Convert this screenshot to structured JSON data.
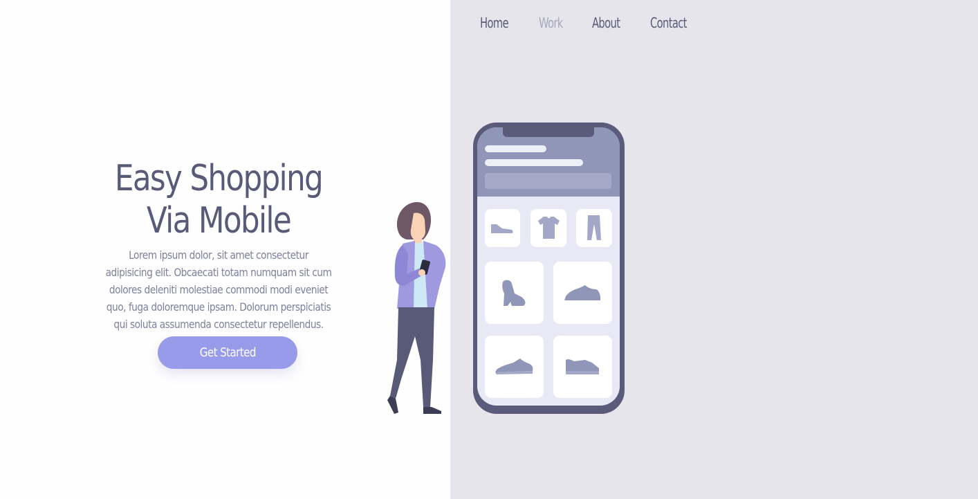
{
  "nav": {
    "items": [
      {
        "label": "Home",
        "active": false
      },
      {
        "label": "Work",
        "active": true
      },
      {
        "label": "About",
        "active": false
      },
      {
        "label": "Contact",
        "active": false
      }
    ]
  },
  "hero": {
    "title_line1": "Easy Shopping",
    "title_line2": "Via Mobile",
    "description": "Lorem ipsum dolor, sit amet consectetur adipisicing elit. Obcaecati totam numquam sit cum dolores deleniti molestiae commodi modi eveniet quo, fuga doloremque ipsam. Dolorum perspiciatis qui soluta assumenda consectetur repellendus.",
    "cta_label": "Get Started"
  },
  "colors": {
    "text_primary": "#585a78",
    "nav_active": "#a6a8bf",
    "accent": "#979bea",
    "panel_background": "#e6e5eb",
    "phone_frame": "#5a5a7a"
  },
  "illustration": {
    "icons": [
      "woman-figure-icon",
      "smartphone-icon",
      "shoe-icon",
      "tshirt-icon",
      "pants-icon",
      "boot-icon",
      "sneaker-icon"
    ]
  }
}
